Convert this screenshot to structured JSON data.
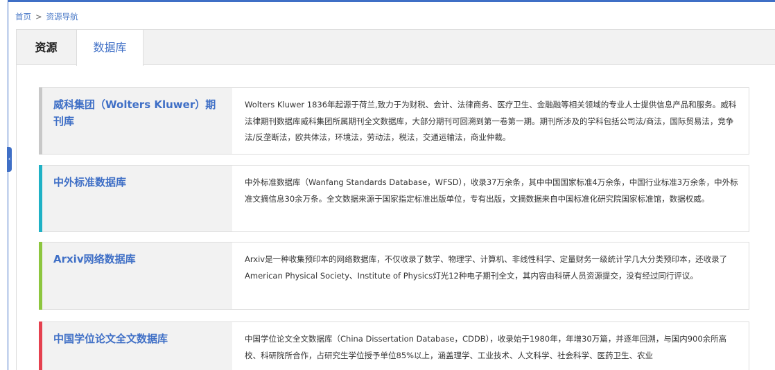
{
  "breadcrumb": {
    "home": "首页",
    "separator": ">",
    "current": "资源导航"
  },
  "tabs": [
    {
      "label": "资源",
      "active": false
    },
    {
      "label": "数据库",
      "active": true
    }
  ],
  "colors": {
    "primary": "#3f6fc6",
    "accent_gray": "#c8c8c8",
    "accent_teal": "#1fb1c5",
    "accent_green": "#8dc63f",
    "accent_red": "#e5414f"
  },
  "databases": [
    {
      "title": "威科集团（Wolters Kluwer）期刊库",
      "description": "Wolters Kluwer 1836年起源于荷兰,致力于为财税、会计、法律商务、医疗卫生、金融融等相关领域的专业人士提供信息产品和服务。威科法律期刊数据库威科集团所属期刊全文数据库，大部分期刊可回溯到第一卷第一期。期刊所涉及的学科包括公司法/商法，国际贸易法，竞争法/反垄断法，欧共体法，环境法，劳动法，税法，交通运输法，商业仲裁。"
    },
    {
      "title": "中外标准数据库",
      "description": "中外标准数据库（Wanfang Standards Database，WFSD），收录37万余条，其中中国国家标准4万余条，中国行业标准3万余条，中外标准文摘信息30余万条。全文数据来源于国家指定标准出版单位，专有出版，文摘数据来自中国标准化研究院国家标准馆，数据权威。"
    },
    {
      "title": "Arxiv网络数据库",
      "description": "Arxiv是一种收集预印本的网络数据库，不仅收录了数学、物理学、计算机、非线性科学、定量财务一级统计学几大分类预印本，还收录了American Physical Society、Institute of Physics灯光12种电子期刊全文，其内容由科研人员资源提交，没有经过同行评议。"
    },
    {
      "title": "中国学位论文全文数据库",
      "description": "中国学位论文全文数据库（China Dissertation Database，CDDB），收录始于1980年，年增30万篇，并逐年回溯，与国内900余所高校、科研院所合作，占研究生学位授予单位85%以上，涵盖理学、工业技术、人文科学、社会科学、医药卫生、农业"
    }
  ]
}
